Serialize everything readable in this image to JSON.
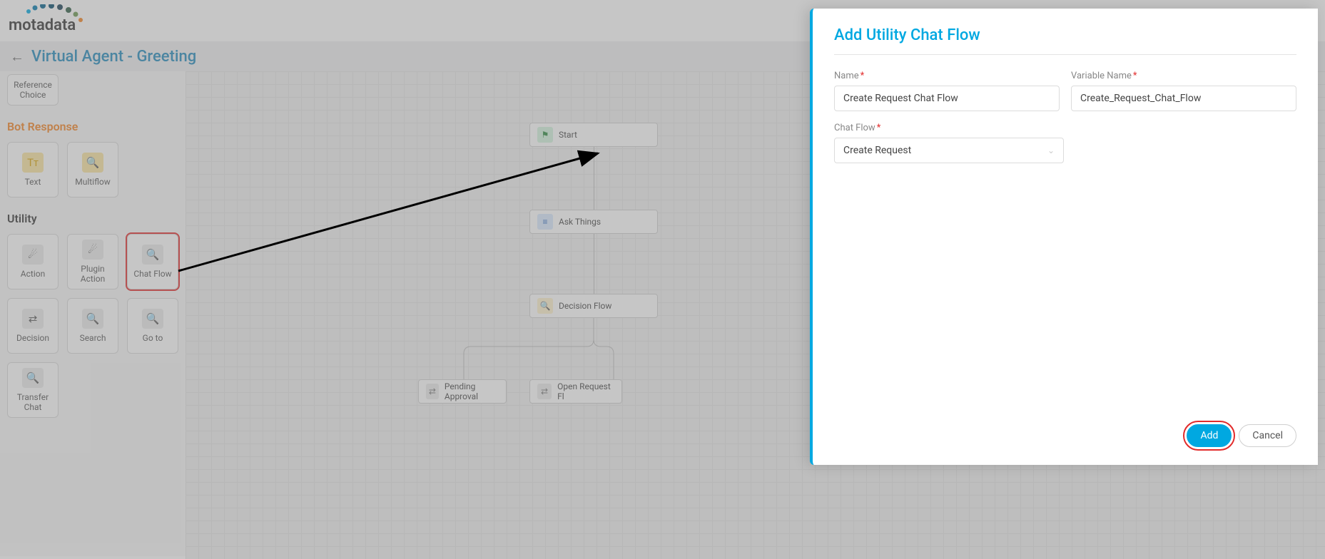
{
  "logo_text": "motadata",
  "page_title": "Virtual Agent - Greeting",
  "reference_tile": "Reference Choice",
  "section_bot": "Bot Response",
  "section_util": "Utility",
  "tiles_bot": [
    {
      "label": "Text",
      "icon": "Tᴛ"
    },
    {
      "label": "Multiflow",
      "icon": "🔍"
    }
  ],
  "tiles_util": [
    {
      "label": "Action",
      "icon": "☄"
    },
    {
      "label": "Plugin Action",
      "icon": "☄"
    },
    {
      "label": "Chat Flow",
      "icon": "🔍"
    },
    {
      "label": "Decision",
      "icon": "⇄"
    },
    {
      "label": "Search",
      "icon": "🔍"
    },
    {
      "label": "Go to",
      "icon": "🔍"
    },
    {
      "label": "Transfer Chat",
      "icon": "🔍"
    }
  ],
  "flow_nodes": {
    "start": "Start",
    "ask": "Ask Things",
    "decision": "Decision Flow",
    "pending": "Pending Approval",
    "openreq": "Open Request Fl"
  },
  "modal": {
    "title": "Add Utility Chat Flow",
    "labels": {
      "name": "Name",
      "variable": "Variable Name",
      "chatflow": "Chat Flow"
    },
    "values": {
      "name": "Create Request Chat Flow",
      "variable": "Create_Request_Chat_Flow",
      "chatflow": "Create Request"
    },
    "buttons": {
      "add": "Add",
      "cancel": "Cancel"
    }
  }
}
